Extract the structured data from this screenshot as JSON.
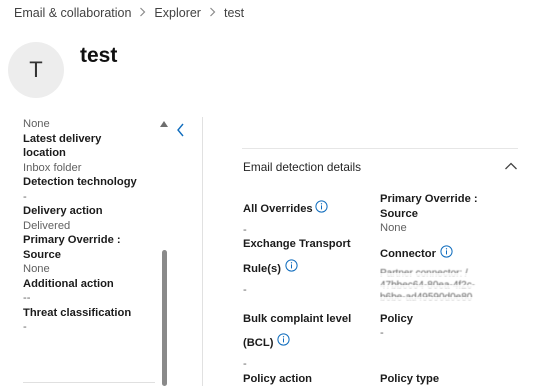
{
  "breadcrumb": {
    "items": [
      "Email & collaboration",
      "Explorer",
      "test"
    ]
  },
  "header": {
    "avatar_initial": "T",
    "title": "test"
  },
  "left_pane": {
    "fields": [
      {
        "label": "",
        "value": "None"
      },
      {
        "label": "Latest delivery location",
        "value": "Inbox folder"
      },
      {
        "label": "Detection technology",
        "value": "-"
      },
      {
        "label": "Delivery action",
        "value": "Delivered"
      },
      {
        "label": "Primary Override : Source",
        "value": "None"
      },
      {
        "label": "Additional action",
        "value": "--"
      },
      {
        "label": "Threat classification",
        "value": "-"
      }
    ]
  },
  "details": {
    "section_title": "Email detection details",
    "all_overrides": {
      "label": "All Overrides",
      "value": "-"
    },
    "primary_override": {
      "label": "Primary Override : Source",
      "value": "None"
    },
    "exchange_transport": {
      "label_line1": "Exchange Transport",
      "label_line2": "Rule(s)",
      "value": "-"
    },
    "connector": {
      "label": "Connector",
      "value_lines": [
        "Partner connector: /",
        "47bbec64-80ea-4f2c-",
        "b6be-ad49590d0e80"
      ]
    },
    "bulk_complaint": {
      "label_line1": "Bulk complaint level",
      "label_line2": "(BCL)",
      "value": "-"
    },
    "policy": {
      "label": "Policy",
      "value": "-"
    },
    "policy_action": {
      "label": "Policy action"
    },
    "policy_type": {
      "label": "Policy type"
    }
  },
  "icons": {
    "info": "info-circle-icon",
    "collapse": "chevron-left-icon",
    "section_toggle": "chevron-up-icon",
    "breadcrumb_sep": "chevron-right-icon",
    "scroll_up": "scroll-up-arrow-icon"
  },
  "colors": {
    "accent": "#0f6cbd",
    "avatar_bg": "#ededed"
  }
}
